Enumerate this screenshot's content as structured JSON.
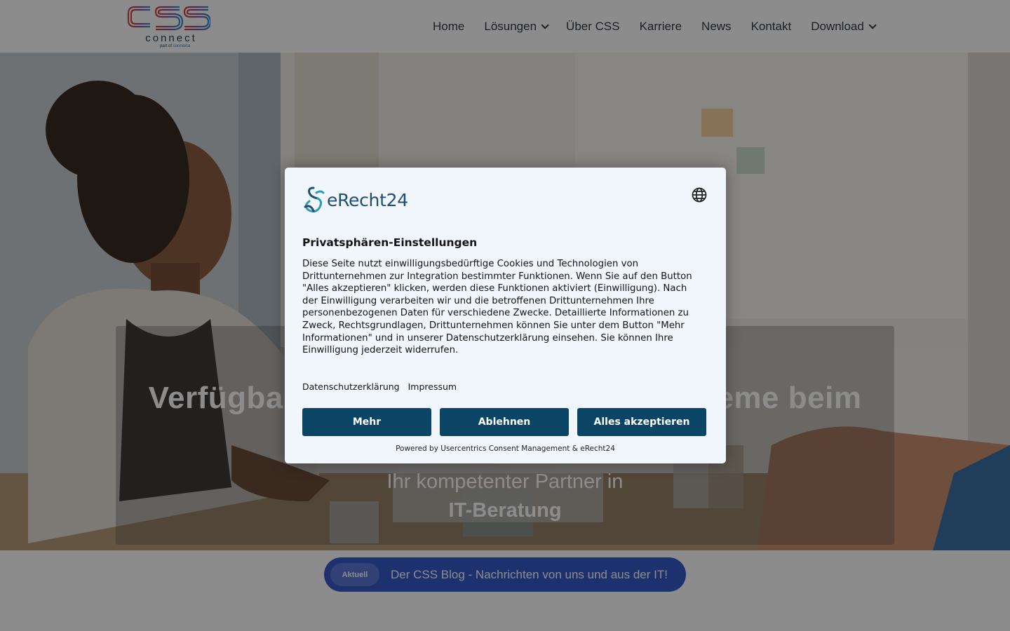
{
  "header": {
    "logo": {
      "word": "connect",
      "sub_prefix": "part of",
      "sub_brand": "connexta",
      "mark": "CSS"
    },
    "nav": [
      {
        "label": "Home",
        "dropdown": false
      },
      {
        "label": "Lösungen",
        "dropdown": true
      },
      {
        "label": "Über CSS",
        "dropdown": false
      },
      {
        "label": "Karriere",
        "dropdown": false
      },
      {
        "label": "News",
        "dropdown": false
      },
      {
        "label": "Kontakt",
        "dropdown": false
      },
      {
        "label": "Download",
        "dropdown": true
      }
    ]
  },
  "hero": {
    "headline_left": "Verfügbar",
    "headline_right": "eme beim",
    "subtitle": "Ihr kompetenter Partner in",
    "subtitle_bold": "IT-Beratung"
  },
  "blog": {
    "badge": "Aktuell",
    "text": "Der CSS Blog - Nachrichten von uns und aus der IT!"
  },
  "consent": {
    "brand": "eRecht24",
    "title": "Privatsphären-Einstellungen",
    "body": "Diese Seite nutzt einwilligungsbedürftige Cookies und Technologien von Drittunternehmen zur Integration bestimmter Funktionen. Wenn Sie auf den Button \"Alles akzeptieren\" klicken, werden diese Funktionen aktiviert (Einwilligung). Nach der Einwilligung verarbeiten wir und die betroffenen Drittunternehmen Ihre personenbezogenen Daten für verschiedene Zwecke. Detaillierte Informationen zu Zweck, Rechtsgrundlagen, Drittunternehmen können Sie unter dem Button \"Mehr Informationen\" und in unserer Datenschutzerklärung einsehen. Sie können Ihre Einwilligung jederzeit widerrufen.",
    "link_privacy": "Datenschutzerklärung",
    "link_imprint": "Impressum",
    "btn_more": "Mehr",
    "btn_deny": "Ablehnen",
    "btn_accept": "Alles akzeptieren",
    "powered": "Powered by Usercentrics Consent Management & eRecht24",
    "lang_icon": "globe-icon"
  },
  "colors": {
    "accent_button": "#0b4566",
    "dialog_bg": "#f1f6fc",
    "blog_pill": "#3659c9",
    "brand_teal": "#1e4f73"
  }
}
